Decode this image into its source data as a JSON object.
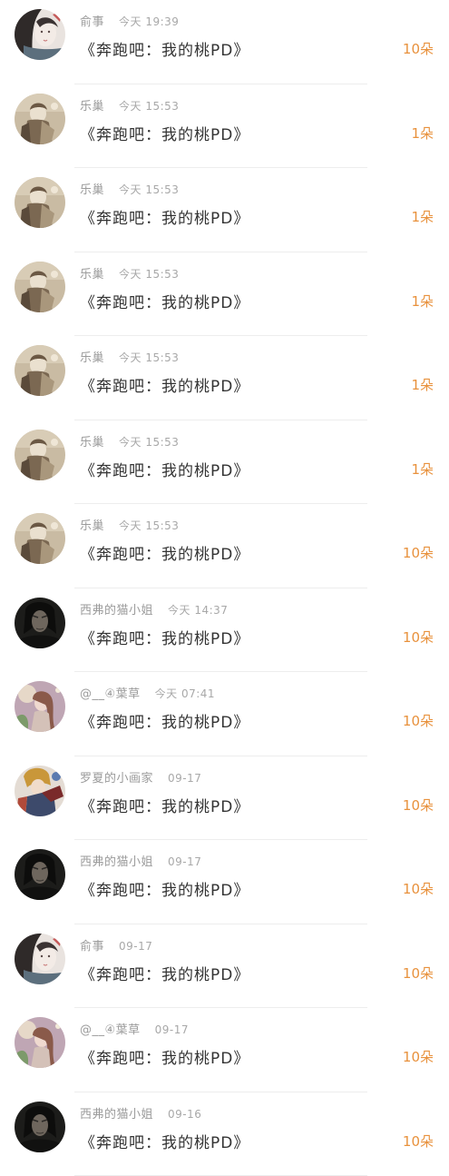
{
  "colors": {
    "count": "#e8913c",
    "meta": "#9b9b9b",
    "title": "#333333",
    "divider": "#ededed"
  },
  "gifts": [
    {
      "user": "俞事",
      "time": "今天 19:39",
      "title": "《奔跑吧：我的桃PD》",
      "count": "10朵",
      "avatar": "avatar-girl-portrait"
    },
    {
      "user": "乐巢",
      "time": "今天 15:53",
      "title": "《奔跑吧：我的桃PD》",
      "count": "1朵",
      "avatar": "avatar-anime-figure"
    },
    {
      "user": "乐巢",
      "time": "今天 15:53",
      "title": "《奔跑吧：我的桃PD》",
      "count": "1朵",
      "avatar": "avatar-anime-figure"
    },
    {
      "user": "乐巢",
      "time": "今天 15:53",
      "title": "《奔跑吧：我的桃PD》",
      "count": "1朵",
      "avatar": "avatar-anime-figure"
    },
    {
      "user": "乐巢",
      "time": "今天 15:53",
      "title": "《奔跑吧：我的桃PD》",
      "count": "1朵",
      "avatar": "avatar-anime-figure"
    },
    {
      "user": "乐巢",
      "time": "今天 15:53",
      "title": "《奔跑吧：我的桃PD》",
      "count": "1朵",
      "avatar": "avatar-anime-figure"
    },
    {
      "user": "乐巢",
      "time": "今天 15:53",
      "title": "《奔跑吧：我的桃PD》",
      "count": "10朵",
      "avatar": "avatar-anime-figure"
    },
    {
      "user": "西弗的猫小姐",
      "time": "今天 14:37",
      "title": "《奔跑吧：我的桃PD》",
      "count": "10朵",
      "avatar": "avatar-dark-portrait"
    },
    {
      "user": "@__④葉草",
      "time": "今天 07:41",
      "title": "《奔跑吧：我的桃PD》",
      "count": "10朵",
      "avatar": "avatar-fairy"
    },
    {
      "user": "罗夏的小画家",
      "time": "09-17",
      "title": "《奔跑吧：我的桃PD》",
      "count": "10朵",
      "avatar": "avatar-character-art"
    },
    {
      "user": "西弗的猫小姐",
      "time": "09-17",
      "title": "《奔跑吧：我的桃PD》",
      "count": "10朵",
      "avatar": "avatar-dark-portrait"
    },
    {
      "user": "俞事",
      "time": "09-17",
      "title": "《奔跑吧：我的桃PD》",
      "count": "10朵",
      "avatar": "avatar-girl-portrait"
    },
    {
      "user": "@__④葉草",
      "time": "09-17",
      "title": "《奔跑吧：我的桃PD》",
      "count": "10朵",
      "avatar": "avatar-fairy"
    },
    {
      "user": "西弗的猫小姐",
      "time": "09-16",
      "title": "《奔跑吧：我的桃PD》",
      "count": "10朵",
      "avatar": "avatar-dark-portrait"
    }
  ]
}
